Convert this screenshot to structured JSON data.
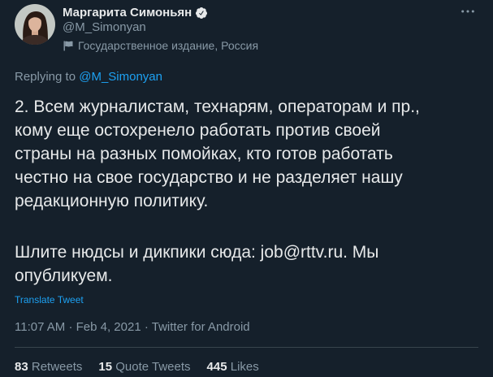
{
  "colors": {
    "background": "#15202B",
    "text": "#E7E9EA",
    "secondary": "#8899A6",
    "link": "#1DA1F2",
    "divider": "#38444D",
    "badge": "#E7E9EA"
  },
  "author": {
    "name": "Маргарита Симоньян",
    "handle": "@M_Simonyan",
    "verified": true,
    "avatar_icon": "avatar",
    "verified_icon": "verified-badge-icon",
    "label_icon": "flag-icon",
    "label": "Государственное издание, Россия"
  },
  "header": {
    "more_icon": "more-icon"
  },
  "reply": {
    "prefix": "Replying to",
    "handle": "@M_Simonyan"
  },
  "tweet": {
    "paragraphs": [
      {
        "lines": [
          "2. Всем журналистам, технарям, операторам и пр.,",
          "кому еще остохренело работать против своей",
          "страны на разных помойках, кто готов работать",
          "честно на свое государство и не разделяет нашу",
          "редакционную политику."
        ]
      },
      {
        "lines": [
          "Шлите нюдсы и дикпики сюда: job@rttv.ru. Мы",
          "опубликуем."
        ]
      }
    ]
  },
  "translate": {
    "label": "Translate Tweet"
  },
  "meta": {
    "time": "11:07 AM",
    "separator": "·",
    "date": "Feb 4, 2021",
    "source": "Twitter for Android"
  },
  "stats": [
    {
      "count": "83",
      "label": "Retweets"
    },
    {
      "count": "15",
      "label": "Quote Tweets"
    },
    {
      "count": "445",
      "label": "Likes"
    }
  ]
}
